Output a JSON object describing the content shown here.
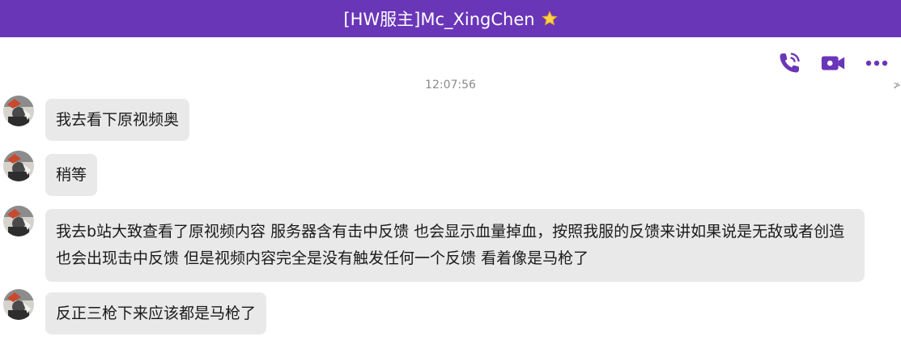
{
  "header": {
    "title": "[HW服主]Mc_XingChen"
  },
  "chat": {
    "timestamp": "12:07:56",
    "edge_mark": "≯",
    "messages": [
      {
        "text": "我去看下原视频奥"
      },
      {
        "text": "稍等"
      },
      {
        "text": "我去b站大致查看了原视频内容 服务器含有击中反馈 也会显示血量掉血，按照我服的反馈来讲如果说是无敌或者创造 也会出现击中反馈 但是视频内容完全是没有触发任何一个反馈 看着像是马枪了"
      },
      {
        "text": "反正三枪下来应该都是马枪了"
      }
    ]
  },
  "icons": {
    "star": "star-icon",
    "call": "phone-icon",
    "video": "video-camera-icon",
    "more": "more-icon"
  },
  "colors": {
    "header_bg": "#6a36b8",
    "icon": "#6a36b8",
    "bubble_bg": "#e9e9e9"
  }
}
